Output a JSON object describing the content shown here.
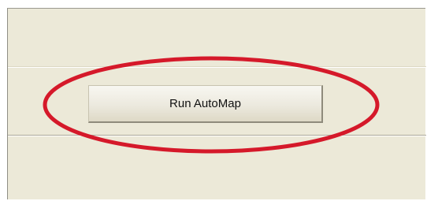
{
  "toolbar": {
    "run_automap_label": "Run AutoMap"
  },
  "annotation": {
    "highlight_color": "#d5192a"
  }
}
